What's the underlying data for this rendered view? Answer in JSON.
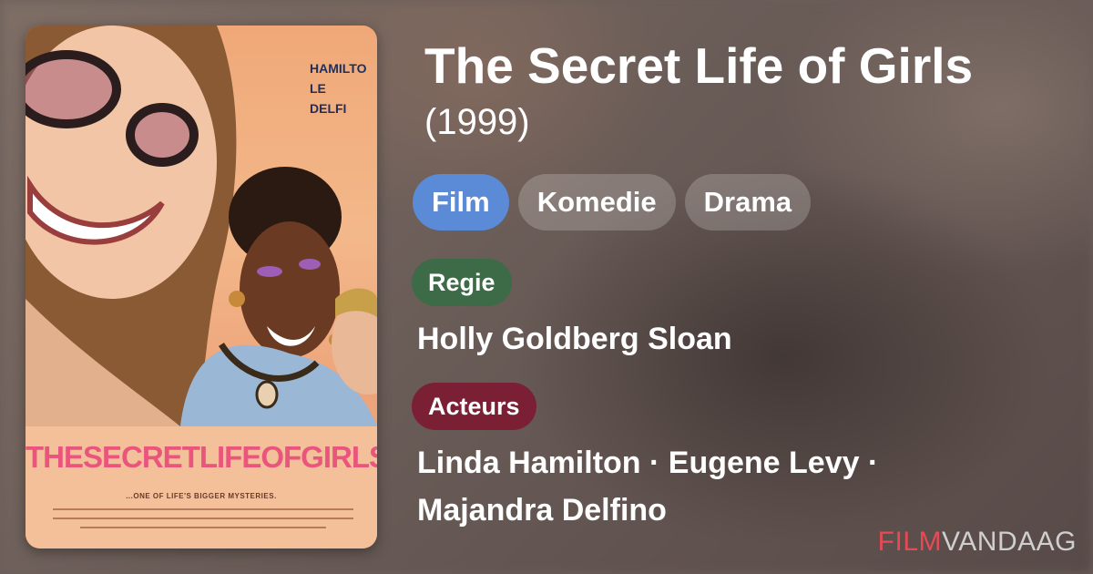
{
  "movie": {
    "title": "The Secret Life of Girls",
    "year": "(1999)"
  },
  "genres": [
    {
      "label": "Film",
      "active": true
    },
    {
      "label": "Komedie",
      "active": false
    },
    {
      "label": "Drama",
      "active": false
    }
  ],
  "directing": {
    "label": "Regie",
    "names": "Holly Goldberg Sloan"
  },
  "cast": {
    "label": "Acteurs",
    "line1": "Linda Hamilton · Eugene Levy ·",
    "line2": "Majandra Delfino"
  },
  "poster": {
    "title_text": "THESECRETLIFEOFGIRLS",
    "tagline": "...ONE OF LIFE'S BIGGER MYSTERIES.",
    "credits": [
      "HAMILTO",
      "LE",
      "DELFI"
    ]
  },
  "brand": {
    "part1": "FILM",
    "part2": "VANDAAG"
  },
  "colors": {
    "film_chip": "#5b8ad6",
    "regie_badge": "#3d6b47",
    "acteurs_badge": "#7b1f34",
    "brand_red": "#e84a55"
  }
}
